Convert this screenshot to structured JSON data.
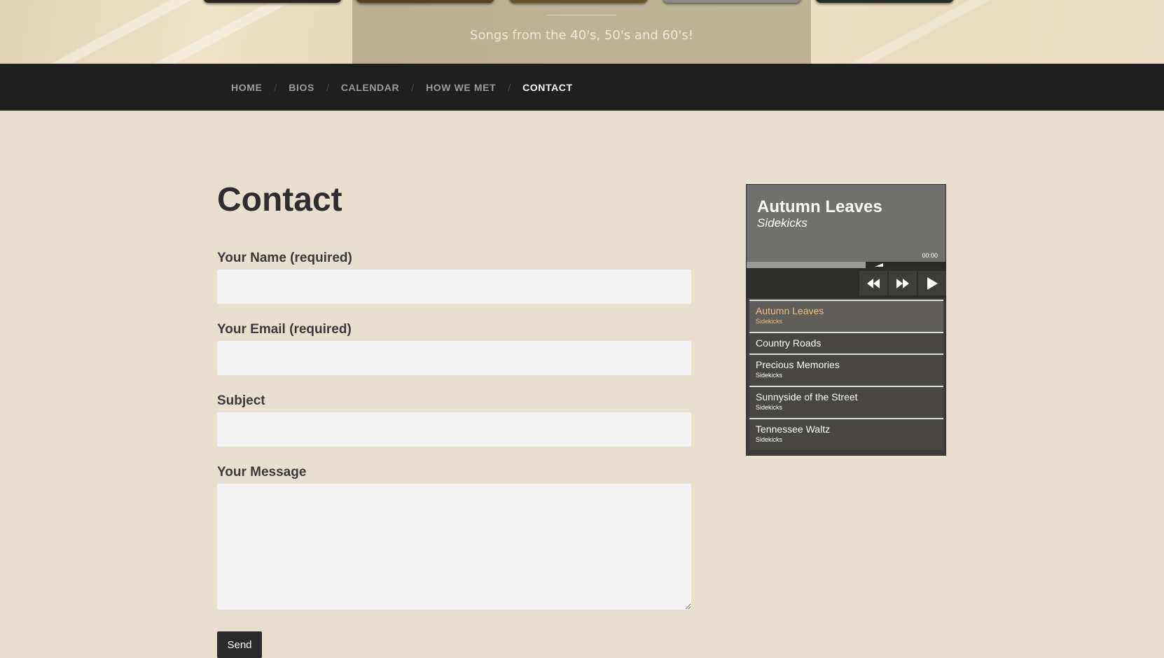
{
  "header": {
    "tagline": "Songs from the 40's, 50's and 60's!"
  },
  "nav": {
    "items": [
      {
        "label": "HOME",
        "active": false
      },
      {
        "label": "BIOS",
        "active": false
      },
      {
        "label": "CALENDAR",
        "active": false
      },
      {
        "label": "HOW WE MET",
        "active": false
      },
      {
        "label": "CONTACT",
        "active": true
      }
    ],
    "separator": "/"
  },
  "main": {
    "title": "Contact",
    "form": {
      "name_label": "Your Name (required)",
      "name_value": "",
      "email_label": "Your Email (required)",
      "email_value": "",
      "subject_label": "Subject",
      "subject_value": "",
      "message_label": "Your Message",
      "message_value": "",
      "send_label": "Send"
    }
  },
  "player": {
    "now_playing_title": "Autumn Leaves",
    "now_playing_artist": "Sidekicks",
    "time": "00:00",
    "progress": 0.0,
    "volume": 0.6,
    "icons": {
      "rewind": "rewind-icon",
      "forward": "fast-forward-icon",
      "play": "play-icon"
    },
    "playlist": [
      {
        "title": "Autumn Leaves",
        "artist": "Sidekicks",
        "current": true
      },
      {
        "title": "Country Roads",
        "artist": "",
        "current": false
      },
      {
        "title": "Precious Memories",
        "artist": "Sidekicks",
        "current": false
      },
      {
        "title": "Sunnyside of the Street",
        "artist": "Sidekicks",
        "current": false
      },
      {
        "title": "Tennessee Waltz",
        "artist": "Sidekicks",
        "current": false
      }
    ],
    "colors": {
      "current_track": "#f0c07c",
      "header_bg": "#70716d"
    }
  }
}
